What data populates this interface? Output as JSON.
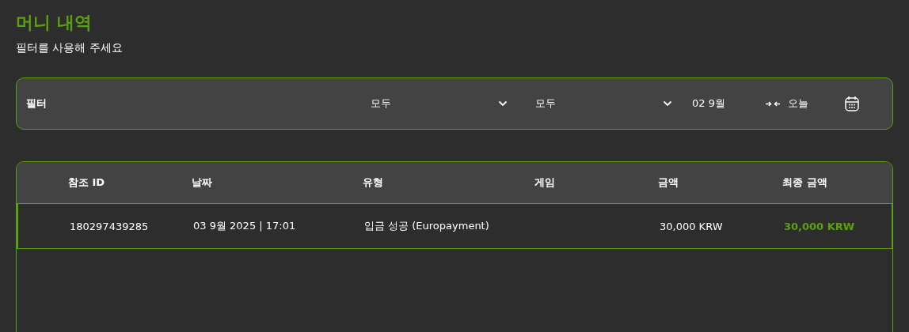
{
  "title": "머니 내역",
  "subtitle": "필터를 사용해 주세요",
  "filter": {
    "label": "필터",
    "selects": [
      {
        "value": "모두"
      },
      {
        "value": "모두"
      }
    ],
    "date_from": "02 9월",
    "date_to": "오늘"
  },
  "table": {
    "columns": [
      "참조 ID",
      "날짜",
      "유형",
      "게임",
      "금액",
      "최종 금액"
    ],
    "rows": [
      {
        "cells": [
          "180297439285",
          "03 9월 2025 | 17:01",
          "입금 성공 (Europayment)",
          "",
          "30,000 KRW",
          "30,000 KRW"
        ],
        "selected": true
      }
    ]
  }
}
